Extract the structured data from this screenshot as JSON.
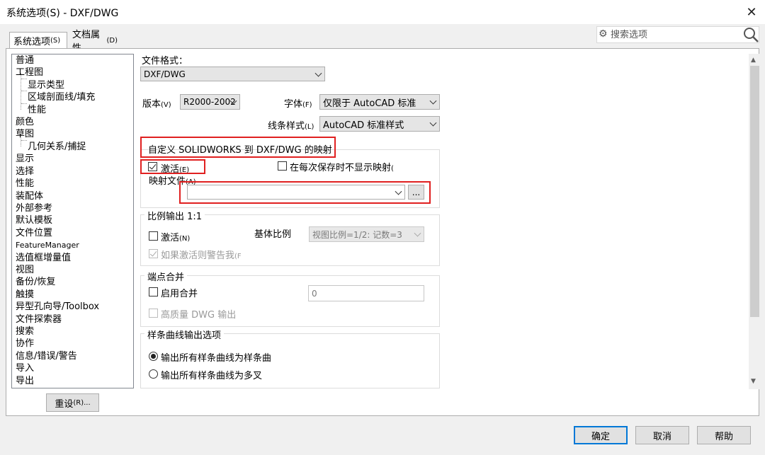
{
  "window": {
    "title": "系统选项(S) - DXF/DWG",
    "close_glyph": "✕"
  },
  "tabs": [
    {
      "label": "系统选项",
      "accel": "(S)"
    },
    {
      "label": "文档属性",
      "accel": "(D)"
    }
  ],
  "search": {
    "placeholder": "搜索选项"
  },
  "tree": {
    "items": [
      {
        "label": "普通",
        "indent": 0
      },
      {
        "label": "工程图",
        "indent": 0
      },
      {
        "label": "显示类型",
        "indent": 1
      },
      {
        "label": "区域剖面线/填充",
        "indent": 1
      },
      {
        "label": "性能",
        "indent": 1
      },
      {
        "label": "颜色",
        "indent": 0
      },
      {
        "label": "草图",
        "indent": 0
      },
      {
        "label": "几何关系/捕捉",
        "indent": 1
      },
      {
        "label": "显示",
        "indent": 0
      },
      {
        "label": "选择",
        "indent": 0
      },
      {
        "label": "性能",
        "indent": 0
      },
      {
        "label": "装配体",
        "indent": 0
      },
      {
        "label": "外部参考",
        "indent": 0
      },
      {
        "label": "默认模板",
        "indent": 0
      },
      {
        "label": "文件位置",
        "indent": 0
      },
      {
        "label": "FeatureManager",
        "indent": 0
      },
      {
        "label": "选值框增量值",
        "indent": 0
      },
      {
        "label": "视图",
        "indent": 0
      },
      {
        "label": "备份/恢复",
        "indent": 0
      },
      {
        "label": "触摸",
        "indent": 0
      },
      {
        "label": "异型孔向导/Toolbox",
        "indent": 0
      },
      {
        "label": "文件探索器",
        "indent": 0
      },
      {
        "label": "搜索",
        "indent": 0
      },
      {
        "label": "协作",
        "indent": 0
      },
      {
        "label": "信息/错误/警告",
        "indent": 0
      },
      {
        "label": "导入",
        "indent": 0
      },
      {
        "label": "导出",
        "indent": 0
      }
    ]
  },
  "reset_button": {
    "label": "重设",
    "accel": "(R)..."
  },
  "file_format": {
    "label": "文件格式：",
    "value": "DXF/DWG"
  },
  "version": {
    "label": "版本",
    "accel": "(V)",
    "value": "R2000-2002"
  },
  "font": {
    "label": "字体",
    "accel": "(F)",
    "value": "仅限于 AutoCAD 标准"
  },
  "line_style": {
    "label": "线条样式",
    "accel": "(L)",
    "value": "AutoCAD 标准样式"
  },
  "mapping": {
    "group_label": "自定义 SOLIDWORKS 到 DXF/DWG 的映射",
    "activate": {
      "label": "激活",
      "accel": "(E)",
      "checked": true
    },
    "no_show_on_save": {
      "label": "在每次保存时不显示映射",
      "accel": "("
    },
    "map_file": {
      "label": "映射文件",
      "accel": "(A)",
      "value": ""
    },
    "browse_label": "..."
  },
  "scale": {
    "group_label": "比例输出 1:1",
    "activate": {
      "label": "激活",
      "accel": "(N)"
    },
    "base_scale_label": "基体比例",
    "base_scale_value": "视图比例=1/2: 记数=3",
    "warn": {
      "label": "如果激活则警告我",
      "accel": "(F"
    }
  },
  "endpoint": {
    "group_label": "端点合并",
    "enable": {
      "label": "启用合并"
    },
    "tolerance_value": "0",
    "hq": {
      "label": "高质量 DWG 输出"
    }
  },
  "spline": {
    "group_label": "样条曲线输出选项",
    "opt_spline": "输出所有样条曲线为样条曲",
    "opt_polyline": "输出所有样条曲线为多叉"
  },
  "footer": {
    "ok": "确定",
    "cancel": "取消",
    "help": "帮助"
  },
  "colors": {
    "highlight_red": "#e02020",
    "default_button_border": "#0078d7"
  }
}
